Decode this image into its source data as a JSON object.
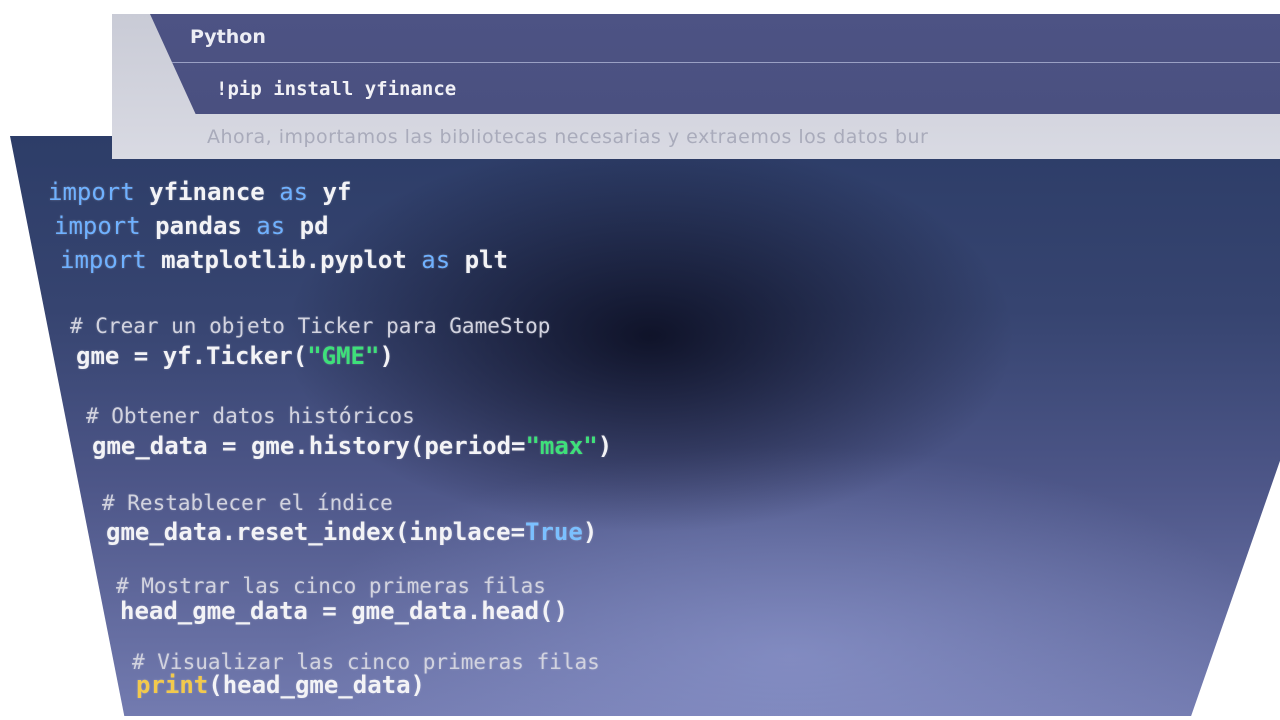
{
  "top_notebook": {
    "cell_language": "Python",
    "command": "!pip install yfinance",
    "paragraph": "Ahora, importamos las bibliotecas necesarias y extraemos los datos bur"
  },
  "code_lines": [
    {
      "tokens": [
        {
          "t": "import",
          "k": "kw"
        },
        {
          "t": " yfinance ",
          "k": "id"
        },
        {
          "t": "as",
          "k": "kw"
        },
        {
          "t": " yf",
          "k": "id"
        }
      ]
    },
    {
      "tokens": [
        {
          "t": "import",
          "k": "kw"
        },
        {
          "t": " pandas ",
          "k": "id"
        },
        {
          "t": "as",
          "k": "kw"
        },
        {
          "t": " pd",
          "k": "id"
        }
      ]
    },
    {
      "tokens": [
        {
          "t": "import",
          "k": "kw"
        },
        {
          "t": " matplotlib.pyplot ",
          "k": "id"
        },
        {
          "t": "as",
          "k": "kw"
        },
        {
          "t": " plt",
          "k": "id"
        }
      ]
    },
    {
      "comment": true,
      "tokens": [
        {
          "t": "# Crear un objeto Ticker para GameStop",
          "k": "cmt"
        }
      ]
    },
    {
      "tokens": [
        {
          "t": "gme = yf.Ticker(",
          "k": "id"
        },
        {
          "t": "\"GME\"",
          "k": "str"
        },
        {
          "t": ")",
          "k": "id"
        }
      ]
    },
    {
      "comment": true,
      "tokens": [
        {
          "t": "# Obtener datos históricos",
          "k": "cmt"
        }
      ]
    },
    {
      "tokens": [
        {
          "t": "gme_data = gme.history(period=",
          "k": "id"
        },
        {
          "t": "\"max\"",
          "k": "str"
        },
        {
          "t": ")",
          "k": "id"
        }
      ]
    },
    {
      "comment": true,
      "tokens": [
        {
          "t": "# Restablecer el índice",
          "k": "cmt"
        }
      ]
    },
    {
      "tokens": [
        {
          "t": "gme_data.reset_index(inplace=",
          "k": "id"
        },
        {
          "t": "True",
          "k": "bool"
        },
        {
          "t": ")",
          "k": "id"
        }
      ]
    },
    {
      "comment": true,
      "tokens": [
        {
          "t": "# Mostrar las cinco primeras filas",
          "k": "cmt"
        }
      ]
    },
    {
      "tokens": [
        {
          "t": "head_gme_data = gme_data.head()",
          "k": "id"
        }
      ]
    },
    {
      "comment": true,
      "tokens": [
        {
          "t": "# Visualizar las cinco primeras filas",
          "k": "cmt"
        }
      ]
    },
    {
      "tokens": [
        {
          "t": "print",
          "k": "fn"
        },
        {
          "t": "(head_gme_data)",
          "k": "id"
        }
      ]
    }
  ],
  "colors": {
    "keyword": "#6fb1ff",
    "identifier": "#f3f3f6",
    "string": "#3ee07a",
    "boolean": "#7bc0ff",
    "builtin": "#f2c94c",
    "comment": "#d2d3df"
  }
}
